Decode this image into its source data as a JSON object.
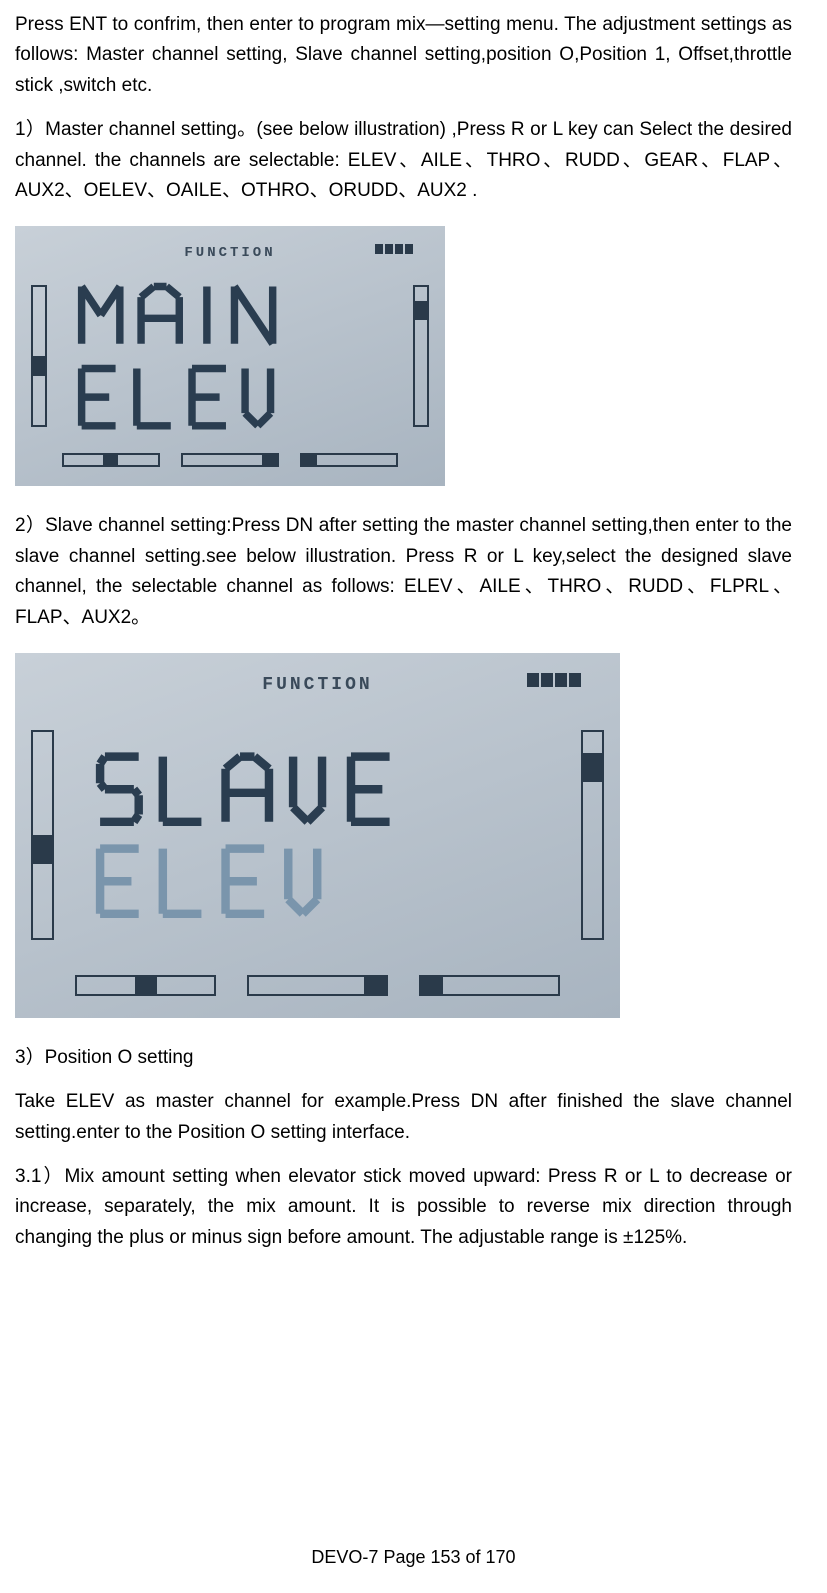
{
  "paragraphs": {
    "intro": "Press ENT to confrim, then enter to program mix—setting menu. The adjustment settings as follows: Master channel setting, Slave channel setting,position O,Position 1, Offset,throttle stick ,switch etc.",
    "master": "1）Master channel setting。(see below illustration) ,Press R or L key can Select the desired channel. the channels are selectable: ELEV、AILE、THRO、RUDD、GEAR、FLAP、AUX2、OELEV、OAILE、OTHRO、ORUDD、AUX2 .",
    "slave": "2）Slave channel setting:Press DN after setting the master channel setting,then enter to the slave channel setting.see below illustration. Press R or L key,select the designed slave channel, the selectable channel as follows: ELEV、AILE、THRO、RUDD、FLPRL、FLAP、AUX2。",
    "position_o_title": "3）Position O setting",
    "position_o_body": "Take ELEV as master channel for example.Press DN after finished the slave channel setting.enter to the Position O setting interface.",
    "mix_amount": "3.1）Mix amount setting when elevator stick moved upward: Press R or L to decrease or increase, separately, the mix amount. It is possible to reverse mix direction through changing the plus or minus sign before amount. The adjustable range is ±125%."
  },
  "lcd1": {
    "header_label": "FUNCTION",
    "line1": "MAIN",
    "line2": "ELEV"
  },
  "lcd2": {
    "header_label": "FUNCTION",
    "line1": "SLAVE",
    "line2": "ELEV"
  },
  "footer": "DEVO-7     Page 153 of 170"
}
